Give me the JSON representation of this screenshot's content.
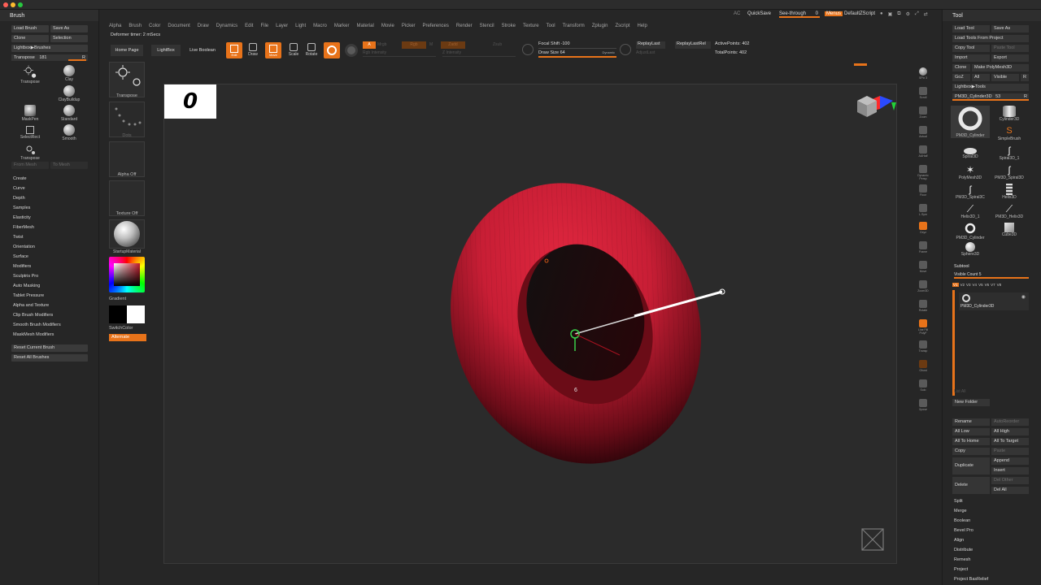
{
  "window": {
    "traffic_lights": [
      "#ff5f57",
      "#febc2e",
      "#28c840"
    ]
  },
  "brush_panel": {
    "title": "Brush",
    "buttons": [
      "Load Brush",
      "Save As",
      "Clone",
      "Selection",
      "Lightbox▶Brushes"
    ],
    "transpose_slider": {
      "label": "Transpose",
      "value": "181",
      "r": "R"
    },
    "brushes": [
      "Transpose",
      "Clay",
      "ClayBuildup",
      "MaskPen",
      "Standard",
      "SelectRect",
      "Smooth",
      "Transpose"
    ],
    "from_mesh": "From Mesh",
    "to_mesh": "To Mesh",
    "menu": [
      "Create",
      "Curve",
      "Depth",
      "Samples",
      "Elasticity",
      "FiberMesh",
      "Twist",
      "Orientation",
      "Surface",
      "Modifiers",
      "Sculptris Pro",
      "Auto Masking",
      "Tablet Pressure",
      "Alpha and Texture",
      "Clip Brush Modifiers",
      "Smooth Brush Modifiers",
      "MaskMesh Modifiers"
    ],
    "reset_current": "Reset Current Brush",
    "reset_all": "Reset All Brushes"
  },
  "col2": {
    "transpose": "Transpose",
    "dots": "Dots",
    "alpha_off": "Alpha Off",
    "texture_off": "Texture Off",
    "material": "StartupMaterial",
    "gradient": "Gradient",
    "switch_color": "SwitchColor",
    "alternate": "Alternate"
  },
  "top_menu": [
    "Alpha",
    "Brush",
    "Color",
    "Document",
    "Draw",
    "Dynamics",
    "Edit",
    "File",
    "Layer",
    "Light",
    "Macro",
    "Marker",
    "Material",
    "Movie",
    "Picker",
    "Preferences",
    "Render",
    "Stencil",
    "Stroke",
    "Texture",
    "Tool",
    "Transform",
    "Zplugin",
    "Zscript",
    "Help"
  ],
  "deformer_timer": "Deformer timer: 2 mSecs",
  "shelf": {
    "home_page": "Home Page",
    "lightbox": "LightBox",
    "live_boolean": "Live Boolean",
    "tools": [
      "Edit",
      "Draw",
      "Move",
      "Scale",
      "Rotate"
    ],
    "mrgb": "Mrgb",
    "rgb": "Rgb",
    "m": "M",
    "zadd": "Zadd",
    "zsub": "Zsub",
    "rgb_intensity": "Rgb Intensity",
    "z_intensity": "Z Intensity",
    "focal_shift": "Focal Shift -100",
    "draw_size": "Draw Size 64",
    "dynamic": "Dynamic",
    "replay_last": "ReplayLast",
    "replay_last_rel": "ReplayLastRel",
    "adjust_last": "AdjustLast",
    "active_points": "ActivePoints: 402",
    "total_points": "TotalPoints: 402"
  },
  "top_right": {
    "ac": "AC",
    "quicksave": "QuickSave",
    "see_through": "See-through",
    "see_through_value": "0",
    "menus": "Menus",
    "default_zscript": "DefaultZScript"
  },
  "viewport": {
    "frame_number": "0",
    "point_label": "6"
  },
  "right_strip": [
    "SPix 3",
    "Scroll",
    "Zoom",
    "Actual",
    "AAHalf",
    "Dynamic Persp",
    "Floor",
    "L.Sym",
    "Gxyz",
    "Frame",
    "Move",
    "Zoom3D",
    "Rotate",
    "Line Fill PolyF",
    "Transp",
    "Ghost",
    "Solo",
    "Xpose"
  ],
  "tool_panel": {
    "title": "Tool",
    "buttons": [
      "Load Tool",
      "Save As",
      "Load Tools From Project",
      "Copy Tool",
      "Paste Tool",
      "Import",
      "Export",
      "Clone",
      "Make PolyMesh3D",
      "GoZ",
      "All",
      "Visible",
      "R",
      "Lightbox▶Tools"
    ],
    "current_tool": {
      "label": "PM3D_Cylinder3D",
      "value": "53",
      "r": "R"
    },
    "tools": [
      "PM3D_Cylinder",
      "Cylinder3D",
      "Spiral3D",
      "SimpleBrush",
      "PolyMesh3D",
      "Spiral3D_1",
      "PM3D_Spiral3C",
      "PM3D_Spiral3D",
      "Helix3D_1",
      "Helix3D",
      "PM3D_Cylinder",
      "PM3D_Helix3D",
      "Sphere3D",
      "Cube3D"
    ],
    "subtool": "Subtool",
    "visible_count": "Visible Count 5",
    "versions": [
      "V1",
      "V2",
      "V3",
      "V4",
      "V5",
      "V6",
      "V7",
      "V8"
    ],
    "subtool_item": "PM3D_Cylinder3D",
    "list_all": "List All",
    "new_folder": "New Folder",
    "rename": "Rename",
    "auto_reorder": "AutoReorder",
    "all_low": "All Low",
    "all_high": "All High",
    "all_to_home": "All To Home",
    "all_to_target": "All To Target",
    "copy": "Copy",
    "paste": "Paste",
    "duplicate": "Duplicate",
    "append": "Append",
    "insert": "Insert",
    "delete": "Delete",
    "del_other": "Del Other",
    "del_all": "Del All",
    "menu": [
      "Split",
      "Merge",
      "Boolean",
      "Bevel Pro",
      "Align",
      "Distribute",
      "Remesh",
      "Project",
      "Project BasRelief"
    ]
  },
  "colors": {
    "accent": "#e8731a",
    "mesh": "#c81e35"
  }
}
